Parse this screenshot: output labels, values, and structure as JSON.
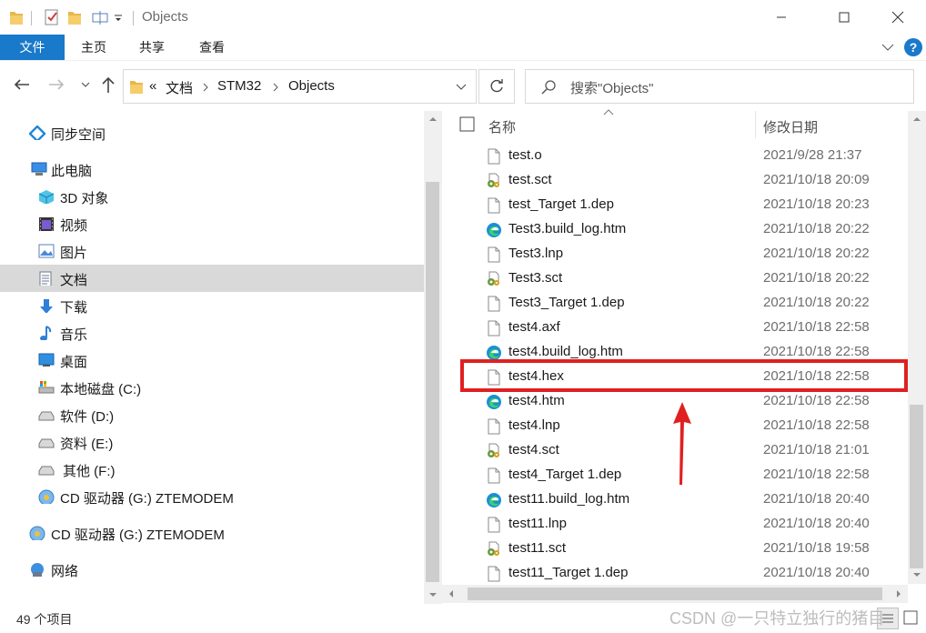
{
  "window": {
    "title": "Objects",
    "minimize_icon": "minimize-icon",
    "maximize_icon": "maximize-icon",
    "close_icon": "close-icon"
  },
  "ribbon": {
    "tabs": [
      {
        "label": "文件",
        "active": true
      },
      {
        "label": "主页"
      },
      {
        "label": "共享"
      },
      {
        "label": "查看"
      }
    ],
    "accent": "#1979ca"
  },
  "address": {
    "overflow": "«",
    "crumbs": [
      "文档",
      "STM32",
      "Objects"
    ],
    "search_placeholder": "搜索\"Objects\""
  },
  "nav": {
    "items": [
      {
        "label": "同步空间",
        "icon": "sync-space-icon"
      },
      {
        "label": "此电脑",
        "icon": "this-pc-icon"
      },
      {
        "label": "3D 对象",
        "icon": "3d-objects-icon"
      },
      {
        "label": "视频",
        "icon": "video-icon"
      },
      {
        "label": "图片",
        "icon": "pictures-icon"
      },
      {
        "label": "文档",
        "icon": "documents-icon",
        "selected": true
      },
      {
        "label": "下载",
        "icon": "download-icon"
      },
      {
        "label": "音乐",
        "icon": "music-icon"
      },
      {
        "label": "桌面",
        "icon": "desktop-icon"
      },
      {
        "label": "本地磁盘 (C:)",
        "icon": "drive-c-icon"
      },
      {
        "label": "软件 (D:)",
        "icon": "drive-icon"
      },
      {
        "label": "资料 (E:)",
        "icon": "drive-icon"
      },
      {
        "label": "其他 (F:)",
        "icon": "drive-icon"
      },
      {
        "label": "CD 驱动器 (G:) ZTEMODEM",
        "icon": "cd-drive-icon"
      },
      {
        "label": "CD 驱动器 (G:) ZTEMODEM",
        "icon": "cd-drive-icon"
      },
      {
        "label": "网络",
        "icon": "network-icon"
      }
    ]
  },
  "files": {
    "headers": {
      "name": "名称",
      "date": "修改日期"
    },
    "rows": [
      {
        "name": "test.o",
        "date": "2021/9/28 21:37",
        "type": "file"
      },
      {
        "name": "test.sct",
        "date": "2021/10/18 20:09",
        "type": "sct"
      },
      {
        "name": "test_Target 1.dep",
        "date": "2021/10/18 20:23",
        "type": "file"
      },
      {
        "name": "Test3.build_log.htm",
        "date": "2021/10/18 20:22",
        "type": "edge"
      },
      {
        "name": "Test3.lnp",
        "date": "2021/10/18 20:22",
        "type": "file"
      },
      {
        "name": "Test3.sct",
        "date": "2021/10/18 20:22",
        "type": "sct"
      },
      {
        "name": "Test3_Target 1.dep",
        "date": "2021/10/18 20:22",
        "type": "file"
      },
      {
        "name": "test4.axf",
        "date": "2021/10/18 22:58",
        "type": "file"
      },
      {
        "name": "test4.build_log.htm",
        "date": "2021/10/18 22:58",
        "type": "edge"
      },
      {
        "name": "test4.hex",
        "date": "2021/10/18 22:58",
        "type": "file",
        "highlighted": true
      },
      {
        "name": "test4.htm",
        "date": "2021/10/18 22:58",
        "type": "edge"
      },
      {
        "name": "test4.lnp",
        "date": "2021/10/18 22:58",
        "type": "file"
      },
      {
        "name": "test4.sct",
        "date": "2021/10/18 21:01",
        "type": "sct"
      },
      {
        "name": "test4_Target 1.dep",
        "date": "2021/10/18 22:58",
        "type": "file"
      },
      {
        "name": "test11.build_log.htm",
        "date": "2021/10/18 20:40",
        "type": "edge"
      },
      {
        "name": "test11.lnp",
        "date": "2021/10/18 20:40",
        "type": "file"
      },
      {
        "name": "test11.sct",
        "date": "2021/10/18 19:58",
        "type": "sct"
      },
      {
        "name": "test11_Target 1.dep",
        "date": "2021/10/18 20:40",
        "type": "file"
      }
    ]
  },
  "status": {
    "count": "49 个项目"
  },
  "watermark": "CSDN @一只特立独行的猪目",
  "annotation": {
    "color": "#e02020"
  }
}
